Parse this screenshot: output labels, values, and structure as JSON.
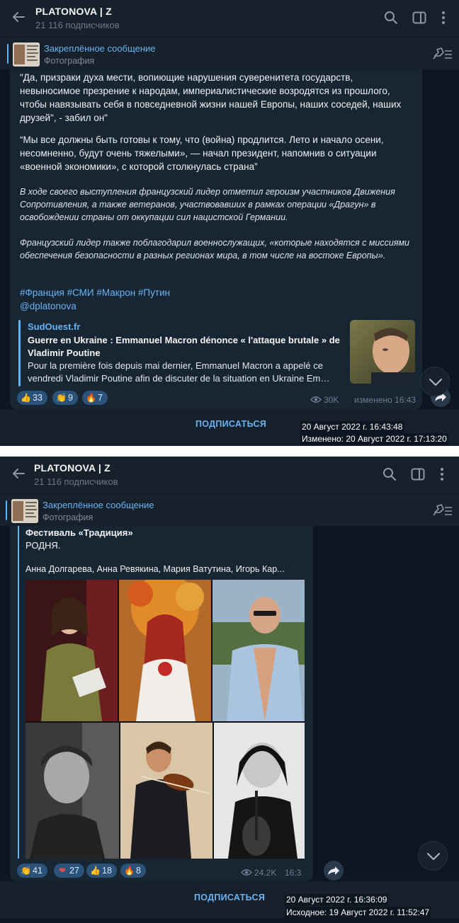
{
  "colors": {
    "bg": "#0e1621",
    "header": "#17212b",
    "bubble": "#182533",
    "accent": "#6ab3f3",
    "reaction": "#2b5278"
  },
  "shot1": {
    "channel_title": "PLATONOVA | Z",
    "subscribers": "21 116 подписчиков",
    "pinned_title": "Закреплённое сообщение",
    "pinned_sub": "Фотография",
    "quote1": "\"Да, призраки духа мести, вопиющие нарушения суверенитета государств, невыносимое презрение к народам, империалистические возродятся из прошлого, чтобы навязывать себя в повседневной жизни нашей Европы, наших соседей, наших друзей\", - забил он\"",
    "quote2": "“Мы все должны быть готовы к тому, что (война) продлится. Лето и начало осени, несомненно, будут очень тяжелыми», — начал президент, напомнив о ситуации «военной экономики», с которой столкнулась страна”",
    "italic1": "В ходе своего выступления французский лидер отметил героизм участников Движения Сопротивления, а также ветеранов, участвовавших в рамках операции «Драгун» в освобождении страны от оккупации сил нацистской Германии.",
    "italic2": "Французский лидер также поблагодарил военнослужащих, «которые находятся с миссиями обеспечения безопасности в разных регионах мира, в том числе на востоке Европы».",
    "hashtags": "#Франция #СМИ #Макрон #Путин",
    "mention": "@dplatonova",
    "link_site": "SudOuest.fr",
    "link_title": "Guerre en Ukraine : Emmanuel Macron dénonce « l'attaque brutale » de Vladimir Poutine",
    "link_desc": "Pour la première fois depuis mai dernier, Emmanuel Macron a appelé ce vendredi Vladimir Poutine afin de discuter de la situation en Ukraine Em…",
    "reactions": [
      {
        "emoji": "👍",
        "count": "33"
      },
      {
        "emoji": "👏",
        "count": "9"
      },
      {
        "emoji": "🔥",
        "count": "7"
      }
    ],
    "views": "30K",
    "edited": "изменено 16:43",
    "subscribe": "ПОДПИСАТЬСЯ",
    "date_line1": "20 Август 2022 г. 16:43:48",
    "date_line2": "Изменено: 20 Август 2022 г. 17:13:20"
  },
  "shot2": {
    "channel_title": "PLATONOVA | Z",
    "subscribers": "21 116 подписчиков",
    "pinned_title": "Закреплённое сообщение",
    "pinned_sub": "Фотография",
    "festival": "Фестиваль «Традиция»",
    "rodnya": "РОДНЯ.",
    "names": "Анна Долгарева, Анна Ревякина, Мария Ватутина, Игорь Кар...",
    "reactions": [
      {
        "emoji": "👏",
        "count": "41"
      },
      {
        "emoji": "❤",
        "count": "27"
      },
      {
        "emoji": "👍",
        "count": "18"
      },
      {
        "emoji": "🔥",
        "count": "8"
      }
    ],
    "views": "24.2K",
    "time": "16:3",
    "subscribe": "ПОДПИСАТЬСЯ",
    "date_line1": "20 Август 2022 г. 16:36:09",
    "date_line2": "Исходное: 19 Август 2022 г. 11:52:47"
  }
}
